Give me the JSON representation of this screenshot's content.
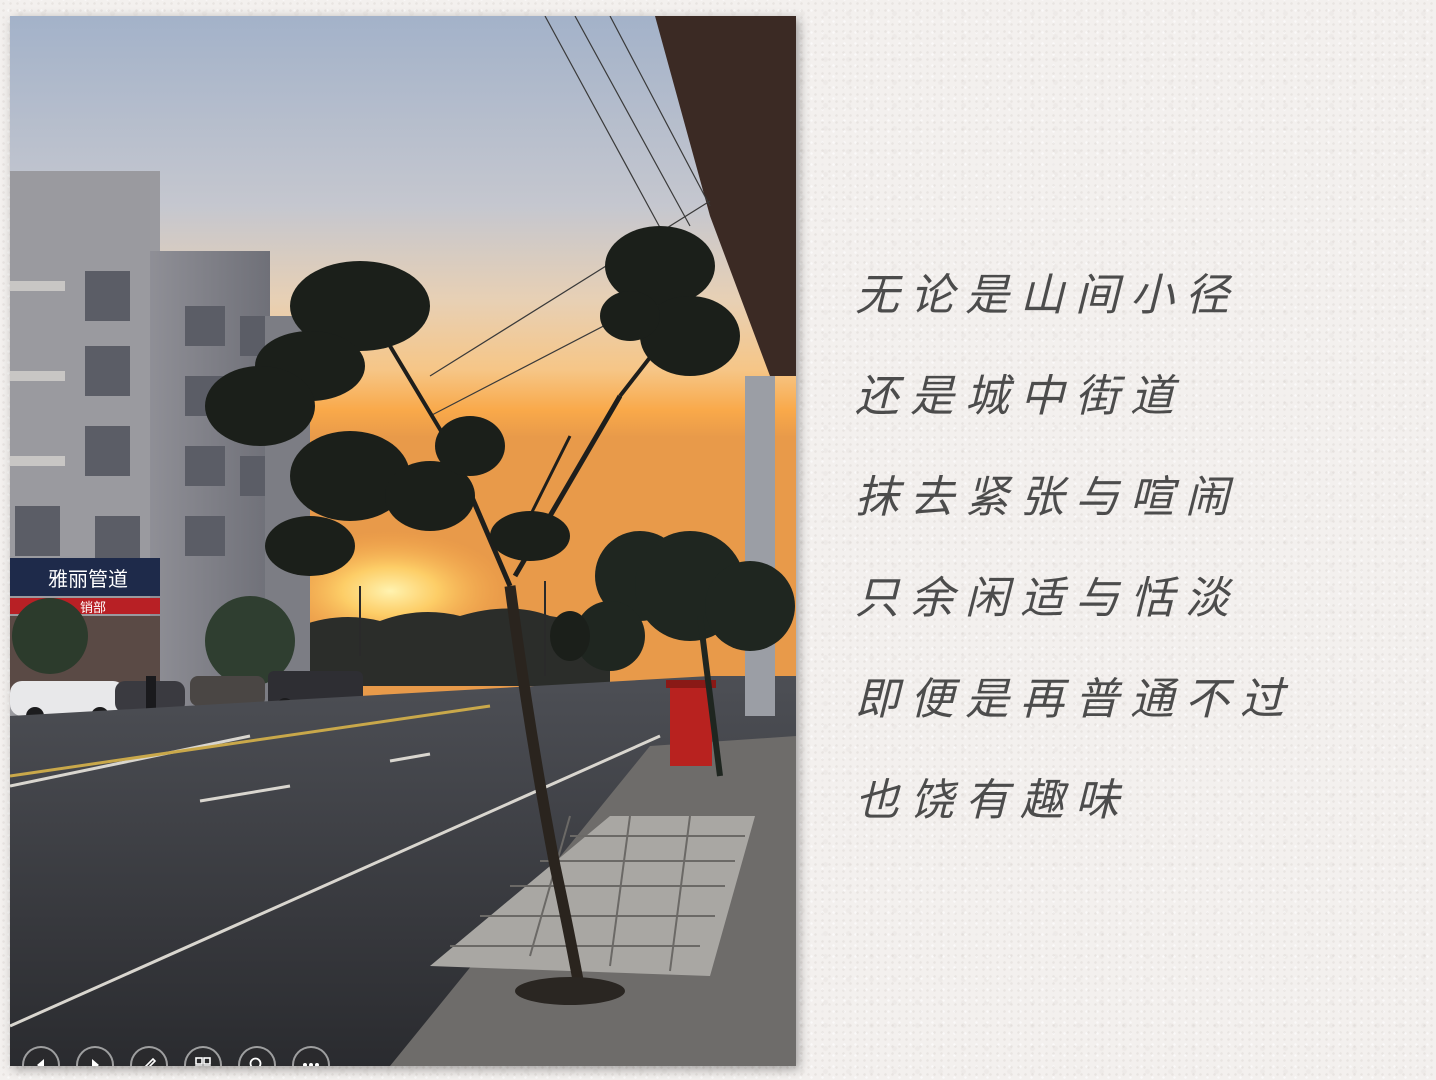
{
  "poem": {
    "lines": [
      "无论是山间小径",
      "还是城中街道",
      "抹去紧张与喧闹",
      "只余闲适与恬淡",
      "即便是再普通不过",
      "也饶有趣味"
    ]
  },
  "photo": {
    "shop_sign": "雅丽管道",
    "shop_sign_2": "销部"
  },
  "controls": {
    "icons": [
      "previous-icon",
      "next-icon",
      "pen-icon",
      "slides-grid-icon",
      "zoom-icon",
      "more-icon"
    ]
  },
  "colors": {
    "text": "#4c4c4c",
    "sky_top": "#9fb0c8",
    "sunset": "#f7a13a"
  }
}
